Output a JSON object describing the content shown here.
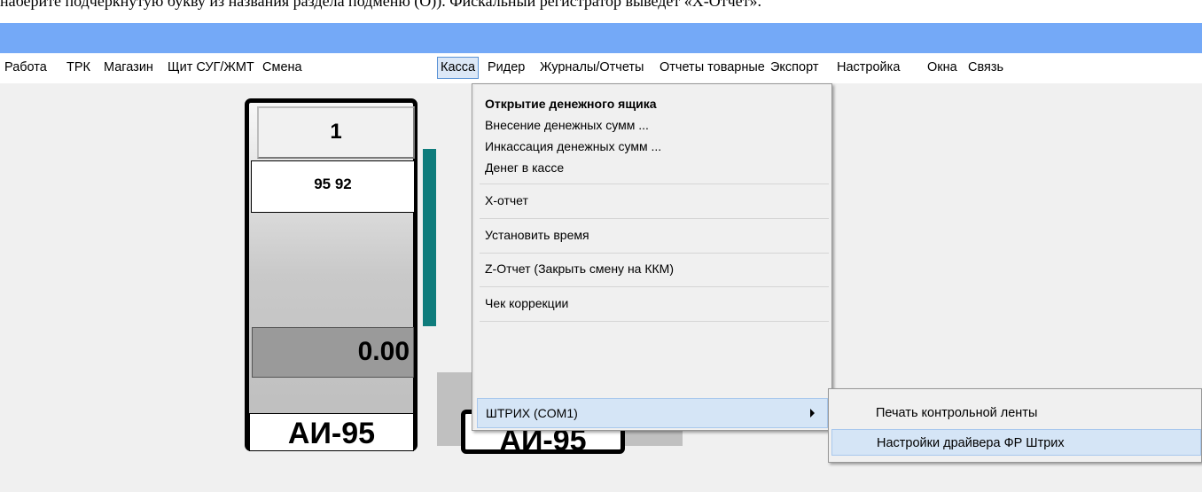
{
  "doc": {
    "line": "наберите подчеркнутую букву из названия раздела подменю (О)). Фискальный регистратор выведет «Х-Отчет»."
  },
  "menubar": {
    "items": [
      {
        "label": "Работа"
      },
      {
        "label": "ТРК"
      },
      {
        "label": "Магазин"
      },
      {
        "label": "Щит СУГ/ЖМТ"
      },
      {
        "label": "Смена"
      },
      {
        "label": "Касса"
      },
      {
        "label": "Ридер"
      },
      {
        "label": "Журналы/Отчеты"
      },
      {
        "label": "Отчеты товарные"
      },
      {
        "label": "Экспорт"
      },
      {
        "label": "Настройка"
      },
      {
        "label": "Окна"
      },
      {
        "label": "Связь"
      }
    ]
  },
  "pump": {
    "number": "1",
    "fuels": "95 92",
    "amount": "0.00",
    "grade": "АИ-95",
    "grade2": "АИ-95"
  },
  "dropdown": {
    "items": [
      "Открытие денежного ящика",
      "Внесение денежных сумм ...",
      "Инкассация денежных сумм ...",
      "Денег в кассе",
      "Х-отчет",
      "Установить время",
      "Z-Отчет (Закрыть смену на ККМ)",
      "Чек коррекции",
      "ШТРИХ (COM1)"
    ]
  },
  "submenu": {
    "items": [
      "Печать контрольной ленты",
      "Настройки драйвера ФР Штрих"
    ]
  }
}
